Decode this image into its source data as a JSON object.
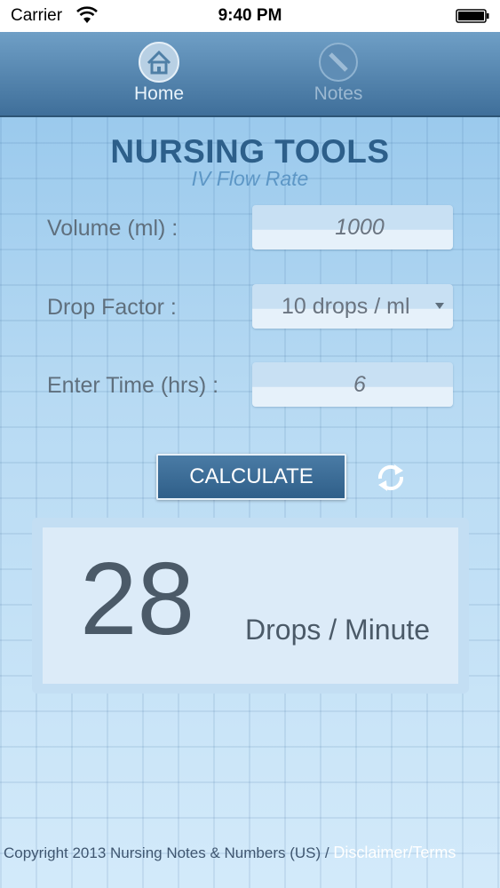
{
  "status_bar": {
    "carrier": "Carrier",
    "time": "9:40 PM",
    "wifi_icon": "wifi-icon",
    "battery_icon": "battery-icon"
  },
  "tabs": [
    {
      "label": "Home",
      "icon": "home-icon",
      "active": true
    },
    {
      "label": "Notes",
      "icon": "pencil-icon",
      "active": false
    }
  ],
  "header": {
    "title": "NURSING TOOLS",
    "subtitle": "IV Flow Rate"
  },
  "form": {
    "volume": {
      "label": "Volume (ml) :",
      "value": "1000"
    },
    "drop_factor": {
      "label": "Drop Factor :",
      "value": "10 drops / ml"
    },
    "time": {
      "label": "Enter Time (hrs) :",
      "value": "6"
    }
  },
  "actions": {
    "calculate_label": "CALCULATE",
    "reset_icon": "refresh-icon"
  },
  "result": {
    "value": "28",
    "unit": "Drops / Minute"
  },
  "footer": {
    "copyright": "Copyright 2013 Nursing Notes & Numbers (US) /",
    "link": "Disclaimer/Terms"
  },
  "colors": {
    "accent": "#2d5f8a",
    "tabbar": "#4a7aa3",
    "background": "#a9d2f0"
  }
}
